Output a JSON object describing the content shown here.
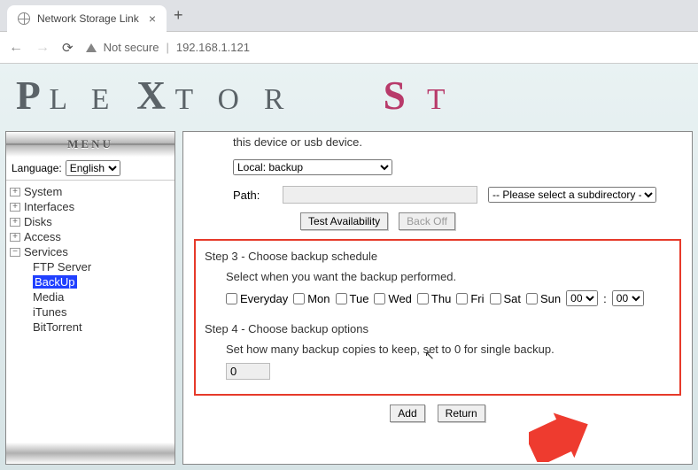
{
  "browser": {
    "tab_title": "Network Storage Link",
    "not_secure": "Not secure",
    "address": "192.168.1.121"
  },
  "brand": {
    "name": "PleXtor St"
  },
  "sidebar": {
    "menu_label": "MENU",
    "language_label": "Language:",
    "language_value": "English",
    "items": [
      {
        "label": "System",
        "expandable": true,
        "expanded": false
      },
      {
        "label": "Interfaces",
        "expandable": true,
        "expanded": false
      },
      {
        "label": "Disks",
        "expandable": true,
        "expanded": false
      },
      {
        "label": "Access",
        "expandable": true,
        "expanded": false
      },
      {
        "label": "Services",
        "expandable": true,
        "expanded": true,
        "children": [
          {
            "label": "FTP Server",
            "selected": false
          },
          {
            "label": "BackUp",
            "selected": true
          },
          {
            "label": "Media",
            "selected": false
          },
          {
            "label": "iTunes",
            "selected": false
          },
          {
            "label": "BitTorrent",
            "selected": false
          }
        ]
      }
    ]
  },
  "main": {
    "intro_fragment": "this device or usb device.",
    "local_select_value": "Local: backup",
    "path_label": "Path:",
    "path_value": "",
    "subdir_placeholder": "-- Please select a subdirectory --",
    "test_btn": "Test Availability",
    "backoff_btn": "Back Off",
    "step3_title": "Step 3 - Choose backup schedule",
    "step3_sub": "Select when you want the backup performed.",
    "days": [
      "Everyday",
      "Mon",
      "Tue",
      "Wed",
      "Thu",
      "Fri",
      "Sat",
      "Sun"
    ],
    "hour": "00",
    "minute": "00",
    "step4_title": "Step 4 - Choose backup options",
    "step4_sub": "Set how many backup copies to keep, set to 0 for single backup.",
    "copies_value": "0",
    "add_btn": "Add",
    "return_btn": "Return"
  }
}
